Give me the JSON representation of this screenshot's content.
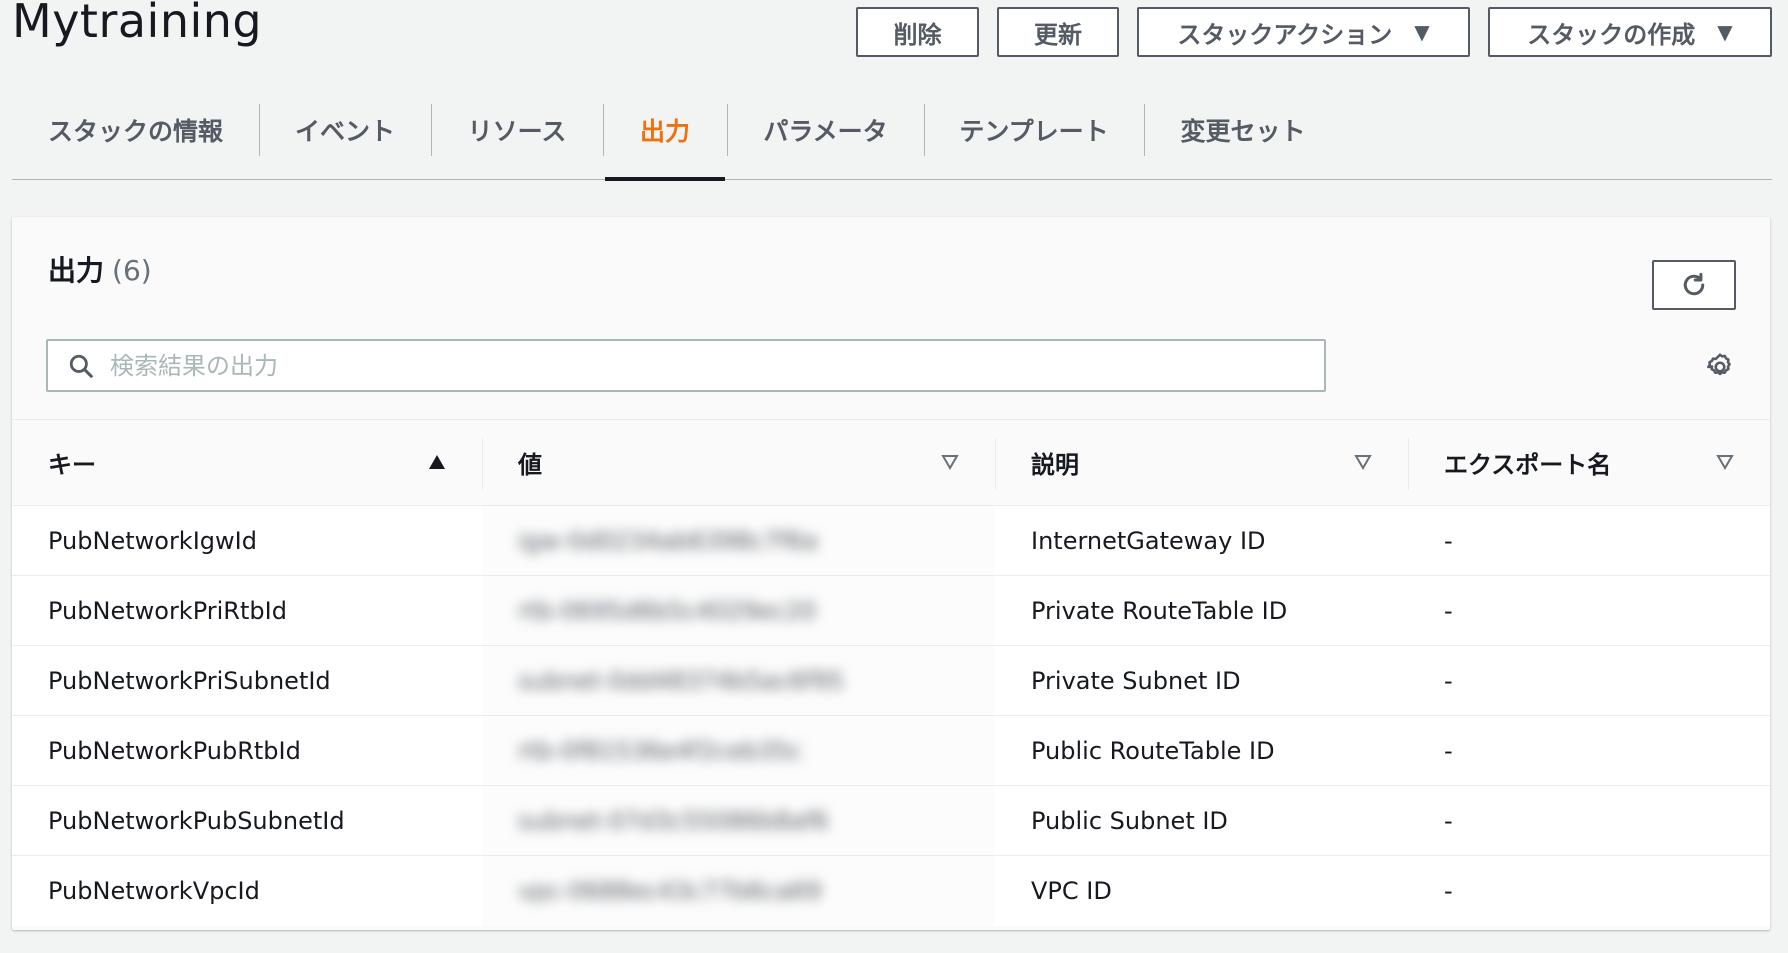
{
  "stack": {
    "title": "Mytraining"
  },
  "header_buttons": {
    "delete": "削除",
    "update": "更新",
    "stack_actions": "スタックアクション",
    "create_stack": "スタックの作成"
  },
  "tabs": [
    {
      "label": "スタックの情報",
      "active": false
    },
    {
      "label": "イベント",
      "active": false
    },
    {
      "label": "リソース",
      "active": false
    },
    {
      "label": "出力",
      "active": true
    },
    {
      "label": "パラメータ",
      "active": false
    },
    {
      "label": "テンプレート",
      "active": false
    },
    {
      "label": "変更セット",
      "active": false
    }
  ],
  "outputs": {
    "title": "出力",
    "count": "(6)",
    "search_placeholder": "検索結果の出力"
  },
  "table": {
    "columns": [
      "キー",
      "値",
      "説明",
      "エクスポート名"
    ],
    "rows": [
      {
        "key": "PubNetworkIgwId",
        "value": "igw-0d0234ab6398c7f6a",
        "description": "InternetGateway ID",
        "export": "-"
      },
      {
        "key": "PubNetworkPriRtbId",
        "value": "rtb-0695d6b5c4029ec20",
        "description": "Private RouteTable ID",
        "export": "-"
      },
      {
        "key": "PubNetworkPriSubnetId",
        "value": "subnet-0dd48374b5ac6f95",
        "description": "Private Subnet ID",
        "export": "-"
      },
      {
        "key": "PubNetworkPubRtbId",
        "value": "rtb-0f81536e4f2ceb35c",
        "description": "Public RouteTable ID",
        "export": "-"
      },
      {
        "key": "PubNetworkPubSubnetId",
        "value": "subnet-07d3c55086b8af6",
        "description": "Public Subnet ID",
        "export": "-"
      },
      {
        "key": "PubNetworkVpcId",
        "value": "vpc-0688ec43c77b6ca69",
        "description": "VPC ID",
        "export": "-"
      }
    ]
  },
  "colors": {
    "accent": "#ec7211",
    "text": "#16191f",
    "muted": "#545b64",
    "border": "#aab7b8"
  }
}
